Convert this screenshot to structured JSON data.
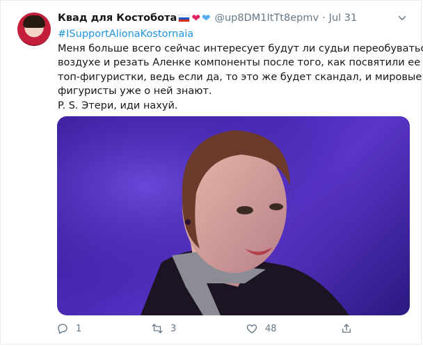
{
  "tweet": {
    "display_name": "Квад для Костобота",
    "name_emojis": [
      "russian-flag",
      "red-heart",
      "blue-heart"
    ],
    "handle": "@up8DM1ItTt8epmv",
    "separator": "·",
    "date": "Jul 31",
    "hashtag": "#ISupportAlionaKostornaia",
    "body_lines": [
      "Меня больше всего сейчас интересует будут ли судьи переобуваться в",
      "воздухе и резать Аленке компоненты после того, как посвятили ее в",
      "топ-фигуристки, ведь если да, то это же будет скандал, и мировые",
      "фигуристы уже о ней знают.",
      "P. S. Этери, иди нахуй."
    ],
    "media_icon": "photo-of-figure-skater",
    "actions": {
      "reply_count": "1",
      "retweet_count": "3",
      "like_count": "48"
    }
  },
  "colors": {
    "link": "#1b95e0",
    "muted": "#657786",
    "heart_red": "#e0245e",
    "heart_blue": "#55acee",
    "media_bg": "#4a2bb8"
  }
}
